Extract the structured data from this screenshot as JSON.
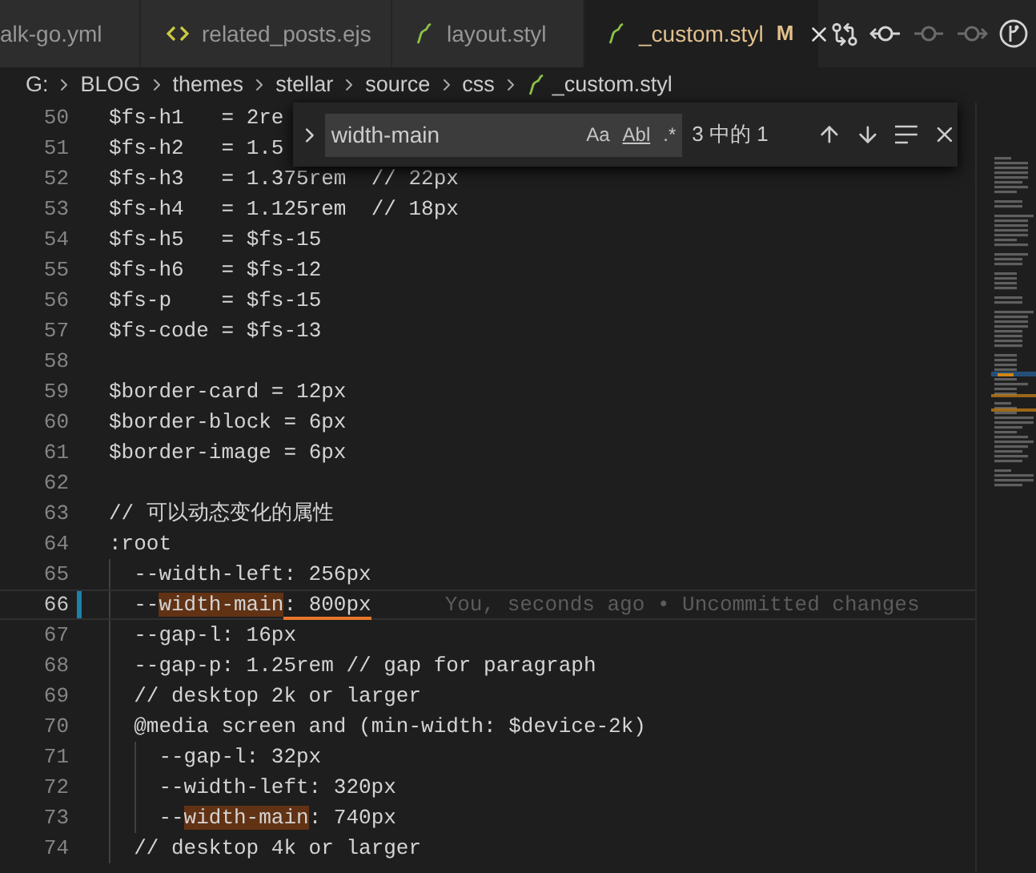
{
  "tabs": [
    {
      "label": "alk-go.yml",
      "kind": "plain",
      "selected": false
    },
    {
      "label": "related_posts.ejs",
      "kind": "code",
      "selected": false
    },
    {
      "label": "layout.styl",
      "kind": "stylus",
      "selected": false
    },
    {
      "label": "_custom.styl",
      "kind": "stylus",
      "selected": true,
      "badge": "M"
    }
  ],
  "toolbar": [
    {
      "kind": "compare",
      "disabled": false
    },
    {
      "kind": "commit-prev",
      "disabled": false
    },
    {
      "kind": "commit",
      "disabled": true
    },
    {
      "kind": "commit-next",
      "disabled": true
    },
    {
      "kind": "graph",
      "disabled": false
    }
  ],
  "breadcrumb": [
    "G:",
    "BLOG",
    "themes",
    "stellar",
    "source",
    "css",
    "_custom.styl"
  ],
  "find": {
    "value": "width-main",
    "options": [
      "Aa",
      "Abl",
      ".*"
    ],
    "count": "3 中的 1"
  },
  "lines": [
    {
      "number": "50",
      "current": false,
      "modified": false,
      "segments": [
        {
          "text": "$fs-h1   = 2re",
          "kind": "plain"
        }
      ]
    },
    {
      "number": "51",
      "current": false,
      "modified": false,
      "segments": [
        {
          "text": "$fs-h2   = 1.5",
          "kind": "plain"
        }
      ]
    },
    {
      "number": "52",
      "current": false,
      "modified": false,
      "segments": [
        {
          "text": "$fs-h3   = 1.375rem  // 22px",
          "kind": "plain"
        }
      ]
    },
    {
      "number": "53",
      "current": false,
      "modified": false,
      "segments": [
        {
          "text": "$fs-h4   = 1.125rem  // 18px",
          "kind": "plain"
        }
      ]
    },
    {
      "number": "54",
      "current": false,
      "modified": false,
      "segments": [
        {
          "text": "$fs-h5   = $fs-15",
          "kind": "plain"
        }
      ]
    },
    {
      "number": "55",
      "current": false,
      "modified": false,
      "segments": [
        {
          "text": "$fs-h6   = $fs-12",
          "kind": "plain"
        }
      ]
    },
    {
      "number": "56",
      "current": false,
      "modified": false,
      "segments": [
        {
          "text": "$fs-p    = $fs-15",
          "kind": "plain"
        }
      ]
    },
    {
      "number": "57",
      "current": false,
      "modified": false,
      "segments": [
        {
          "text": "$fs-code = $fs-13",
          "kind": "plain"
        }
      ]
    },
    {
      "number": "58",
      "current": false,
      "modified": false
    },
    {
      "number": "59",
      "current": false,
      "modified": false,
      "segments": [
        {
          "text": "$border-card = 12px",
          "kind": "plain"
        }
      ]
    },
    {
      "number": "60",
      "current": false,
      "modified": false,
      "segments": [
        {
          "text": "$border-block = 6px",
          "kind": "plain"
        }
      ]
    },
    {
      "number": "61",
      "current": false,
      "modified": false,
      "segments": [
        {
          "text": "$border-image = 6px",
          "kind": "plain"
        }
      ]
    },
    {
      "number": "62",
      "current": false,
      "modified": false
    },
    {
      "number": "63",
      "current": false,
      "modified": false,
      "segments": [
        {
          "text": "// 可以动态变化的属性",
          "kind": "plain"
        }
      ]
    },
    {
      "number": "64",
      "current": false,
      "modified": false,
      "segments": [
        {
          "text": ":root",
          "kind": "plain"
        }
      ]
    },
    {
      "number": "65",
      "current": false,
      "modified": false,
      "segments": [
        {
          "text": "  --width-left: 256px",
          "kind": "plain"
        }
      ]
    },
    {
      "number": "66",
      "current": true,
      "modified": true,
      "blame": "You, seconds ago • Uncommitted changes",
      "segments": [
        {
          "text": "  --",
          "kind": "plain"
        },
        {
          "text": "width-main",
          "kind": "match"
        },
        {
          "text": ": 800px",
          "kind": "warning"
        }
      ]
    },
    {
      "number": "67",
      "current": false,
      "modified": false,
      "segments": [
        {
          "text": "  --gap-l: 16px",
          "kind": "plain"
        }
      ]
    },
    {
      "number": "68",
      "current": false,
      "modified": false,
      "segments": [
        {
          "text": "  --gap-p: 1.25rem // gap for paragraph",
          "kind": "plain"
        }
      ]
    },
    {
      "number": "69",
      "current": false,
      "modified": false,
      "segments": [
        {
          "text": "  // desktop 2k or larger",
          "kind": "plain"
        }
      ]
    },
    {
      "number": "70",
      "current": false,
      "modified": false,
      "segments": [
        {
          "text": "  @media screen and (min-width: $device-2k)",
          "kind": "plain"
        }
      ]
    },
    {
      "number": "71",
      "current": false,
      "modified": false,
      "segments": [
        {
          "text": "    --gap-l: 32px",
          "kind": "plain"
        }
      ]
    },
    {
      "number": "72",
      "current": false,
      "modified": false,
      "segments": [
        {
          "text": "    --width-left: 320px",
          "kind": "plain"
        }
      ]
    },
    {
      "number": "73",
      "current": false,
      "modified": false,
      "segments": [
        {
          "text": "    --",
          "kind": "plain"
        },
        {
          "text": "width-main",
          "kind": "match"
        },
        {
          "text": ": 740px",
          "kind": "plain"
        }
      ]
    },
    {
      "number": "74",
      "current": false,
      "modified": false,
      "segments": [
        {
          "text": "  // desktop 4k or larger",
          "kind": "plain"
        }
      ]
    }
  ]
}
